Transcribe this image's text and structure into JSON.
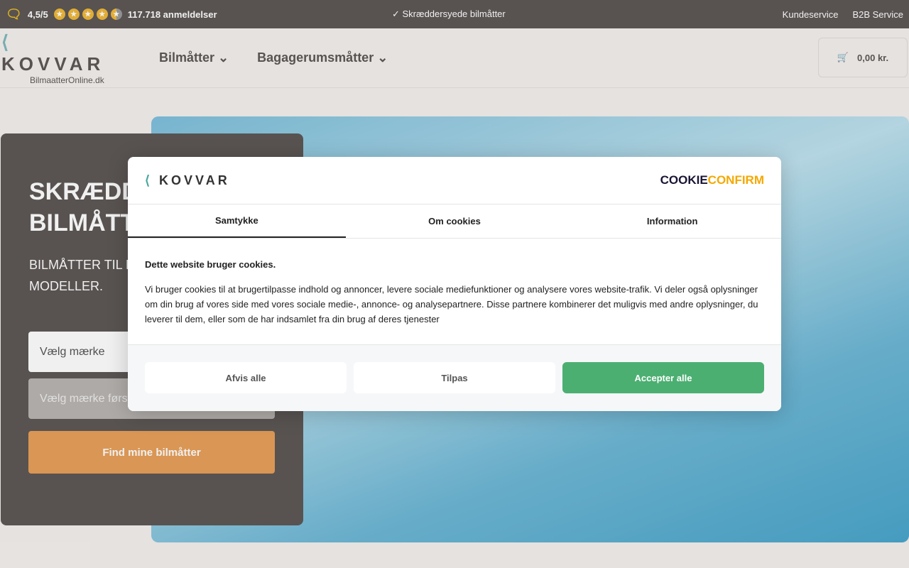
{
  "topbar": {
    "rating": "4,5/5",
    "stars": 4.5,
    "reviews": "117.718 anmeldelser",
    "usp": "Skræddersyede bilmåtter",
    "links": [
      "Kundeservice",
      "B2B Service"
    ]
  },
  "header": {
    "logo": "KOVVAR",
    "logo_sub": "BilmaatterOnline.dk",
    "nav": [
      "Bilmåtter",
      "Bagagerumsmåtter"
    ],
    "cart": "0,00 kr."
  },
  "hero": {
    "title_line1": "SKRÆDD",
    "title_line2": "BILMÅTT",
    "subtitle_line1": "BILMÅTTER TIL M",
    "subtitle_line2": "MODELLER.",
    "brand_select": "Vælg mærke",
    "model_select": "Vælg mærke først",
    "find_button": "Find mine bilmåtter"
  },
  "cookie": {
    "logo": "KOVVAR",
    "provider_a": "COOKIE",
    "provider_b": "CONFIRM",
    "tabs": [
      "Samtykke",
      "Om cookies",
      "Information"
    ],
    "heading": "Dette website bruger cookies.",
    "text": "Vi bruger cookies til at brugertilpasse indhold og annoncer, levere sociale mediefunktioner og analysere vores website-trafik. Vi deler også oplysninger om din brug af vores side med vores sociale medie-, annonce- og analysepartnere. Disse partnere kombinerer det muligvis med andre oplysninger, du leverer til dem, eller som de har indsamlet fra din brug af deres tjenester",
    "buttons": {
      "reject": "Afvis alle",
      "customize": "Tilpas",
      "accept": "Accepter alle"
    }
  },
  "colors": {
    "brand_dark": "#5e5957",
    "accent_orange": "#e8a05a",
    "accept_green": "#4caf72",
    "cookieconfirm_orange": "#f5a800"
  }
}
